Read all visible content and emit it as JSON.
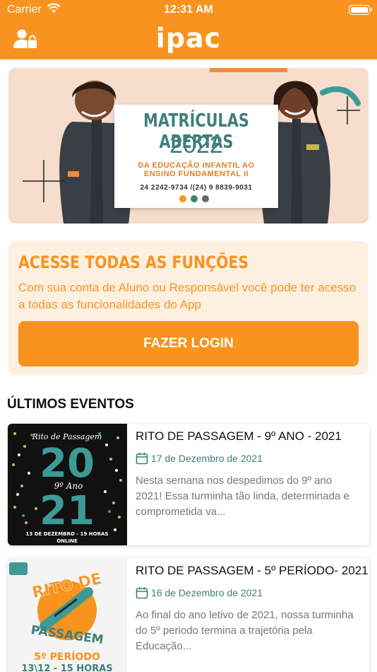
{
  "status_bar": {
    "carrier": "Carrier",
    "time": "12:31 AM"
  },
  "nav": {
    "logo": "ipac",
    "user_icon": "user-lock-icon"
  },
  "banner": {
    "title": "MATRÍCULAS ABERTAS",
    "year": "2022",
    "subtitle_line1": "DA EDUCAÇÃO INFANTIL AO",
    "subtitle_line2": "ENSINO FUNDAMENTAL II",
    "phones": "24 2242-9734 /(24) 9 8839-9031",
    "dot_colors": [
      "#F7931E",
      "#3E7F7B",
      "#666666"
    ]
  },
  "login_card": {
    "title": "ACESSE TODAS AS FUNÇÕES",
    "description": "Com sua conta de Aluno ou Responsável você pode ter acesso a todas as funcionalidades do App",
    "button_label": "FAZER LOGIN"
  },
  "events_section": {
    "title": "ÚLTIMOS EVENTOS",
    "items": [
      {
        "title": "RITO DE PASSAGEM - 9º ANO - 2021",
        "date": "17 de Dezembro de 2021",
        "description": "Nesta semana nos despedimos do 9º ano 2021! Essa turminha tão linda, determinada e comprometida va...",
        "thumb": {
          "heading": "Rito de Passagem",
          "big_top": "20",
          "script": "9º Ano",
          "big_bottom": "21",
          "footer_line1": "13 DE DEZEMBRO - 19 HORAS",
          "footer_line2": "ONLINE"
        }
      },
      {
        "title": "RITO DE PASSAGEM - 5º PERÍODO-  2021",
        "date": "16 de Dezembro de 2021",
        "description": "Ao final do ano letivo de 2021, nossa turminha do 5º periodo termina a trajetória pela Educação...",
        "thumb": {
          "top_word": "RITO DE",
          "bottom_word": "PASSAGEM",
          "period": "5º PERÍODO",
          "when": "13\\12  - 15 HORAS"
        }
      }
    ]
  },
  "colors": {
    "brand_orange": "#F7931E",
    "teal": "#3E7F7B",
    "card_bg": "#FEF0E1"
  }
}
